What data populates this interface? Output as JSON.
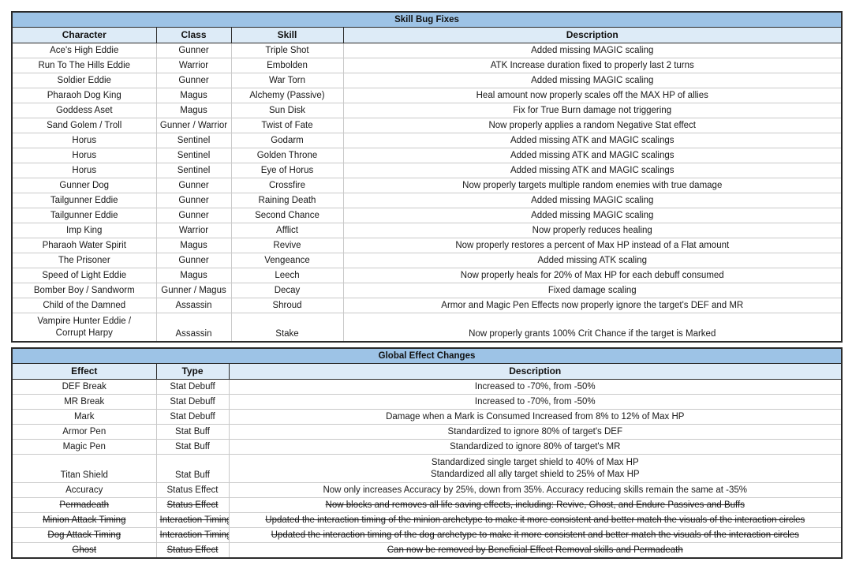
{
  "colors": {
    "title_bar": "#9DC3E6",
    "header_bar": "#DDEBF7",
    "body_text": "#1A1A1A",
    "blue_text": "#5B87DA",
    "struck_text": "#FF2A2A",
    "grid_line": "#C9C9C9",
    "outer_border": "#2B2B2B"
  },
  "skill_bug_fixes": {
    "title": "Skill Bug Fixes",
    "columns": [
      "Character",
      "Class",
      "Skill",
      "Description"
    ],
    "rows": [
      {
        "character": "Ace's High Eddie",
        "class": "Gunner",
        "skill": "Triple Shot",
        "description": "Added missing MAGIC scaling",
        "style": "normal"
      },
      {
        "character": "Run To The Hills Eddie",
        "class": "Warrior",
        "skill": "Embolden",
        "description": "ATK Increase duration fixed to properly last 2 turns",
        "style": "normal"
      },
      {
        "character": "Soldier Eddie",
        "class": "Gunner",
        "skill": "War Torn",
        "description": "Added missing MAGIC scaling",
        "style": "normal"
      },
      {
        "character": "Pharaoh Dog King",
        "class": "Magus",
        "skill": "Alchemy (Passive)",
        "description": "Heal amount now properly scales off the MAX HP of allies",
        "style": "normal"
      },
      {
        "character": "Goddess Aset",
        "class": "Magus",
        "skill": "Sun Disk",
        "description": "Fix for True Burn damage not triggering",
        "style": "normal"
      },
      {
        "character": "Sand Golem / Troll",
        "class": "Gunner / Warrior",
        "skill": "Twist of Fate",
        "description": "Now properly applies a random Negative Stat effect",
        "style": "normal"
      },
      {
        "character": "Horus",
        "class": "Sentinel",
        "skill": "Godarm",
        "description": "Added missing ATK and MAGIC scalings",
        "style": "normal"
      },
      {
        "character": "Horus",
        "class": "Sentinel",
        "skill": "Golden Throne",
        "description": "Added missing ATK and MAGIC scalings",
        "style": "normal"
      },
      {
        "character": "Horus",
        "class": "Sentinel",
        "skill": "Eye of Horus",
        "description": "Added missing ATK and MAGIC scalings",
        "style": "normal"
      },
      {
        "character": "Gunner Dog",
        "class": "Gunner",
        "skill": "Crossfire",
        "description": "Now properly targets multiple random enemies with true damage",
        "style": "normal"
      },
      {
        "character": "Tailgunner Eddie",
        "class": "Gunner",
        "skill": "Raining Death",
        "description": "Added missing MAGIC scaling",
        "style": "normal"
      },
      {
        "character": "Tailgunner Eddie",
        "class": "Gunner",
        "skill": "Second Chance",
        "description": "Added missing MAGIC scaling",
        "style": "normal"
      },
      {
        "character": "Imp King",
        "class": "Warrior",
        "skill": "Afflict",
        "description": "Now properly reduces healing",
        "style": "normal"
      },
      {
        "character": "Pharaoh Water Spirit",
        "class": "Magus",
        "skill": "Revive",
        "description": "Now properly restores a percent of Max HP instead of a Flat amount",
        "style": "blue"
      },
      {
        "character": "The Prisoner",
        "class": "Gunner",
        "skill": "Vengeance",
        "description": "Added missing ATK scaling",
        "style": "blue"
      },
      {
        "character": "Speed of Light Eddie",
        "class": "Magus",
        "skill": "Leech",
        "description": "Now properly heals for 20% of Max HP for each debuff consumed",
        "style": "blue"
      },
      {
        "character": "Bomber Boy / Sandworm",
        "class": "Gunner / Magus",
        "skill": "Decay",
        "description": "Fixed damage scaling",
        "style": "blue"
      },
      {
        "character": "Child of the Damned",
        "class": "Assassin",
        "skill": "Shroud",
        "description": "Armor and Magic Pen Effects now properly ignore the target's DEF and MR",
        "style": "blue"
      },
      {
        "character": "Vampire Hunter Eddie /\nCorrupt Harpy",
        "class": "Assassin",
        "skill": "Stake",
        "description": "Now properly grants 100% Crit Chance if the target is Marked",
        "style": "blue",
        "tall": true
      }
    ]
  },
  "global_effect_changes": {
    "title": "Global Effect Changes",
    "columns": [
      "Effect",
      "Type",
      "Description"
    ],
    "rows": [
      {
        "effect": "DEF Break",
        "type": "Stat Debuff",
        "description": "Increased to -70%, from -50%",
        "style": "normal"
      },
      {
        "effect": "MR Break",
        "type": "Stat Debuff",
        "description": "Increased to -70%, from -50%",
        "style": "normal"
      },
      {
        "effect": "Mark",
        "type": "Stat Debuff",
        "description": "Damage when a Mark is Consumed Increased from 8% to 12% of Max HP",
        "style": "normal"
      },
      {
        "effect": "Armor Pen",
        "type": "Stat Buff",
        "description": "Standardized to ignore 80% of target's DEF",
        "style": "blue"
      },
      {
        "effect": "Magic Pen",
        "type": "Stat Buff",
        "description": "Standardized to ignore 80% of target's MR",
        "style": "blue"
      },
      {
        "effect": "Titan Shield",
        "type": "Stat Buff",
        "description": "Standardized single target shield to 40% of Max HP\nStandardized all ally target shield to 25% of Max HP",
        "style": "blue",
        "tall": true
      },
      {
        "effect": "Accuracy",
        "type": "Status Effect",
        "description": "Now only increases Accuracy by 25%, down from 35%. Accuracy reducing skills remain the same at -35%",
        "style": "normal"
      },
      {
        "effect": "Permadeath",
        "type": "Status Effect",
        "description": "Now blocks and removes all life saving effects, including: Revive, Ghost, and Endure Passives and Buffs",
        "style": "struck"
      },
      {
        "effect": "Minion Attack Timing",
        "type": "Interaction Timing",
        "description": "Updated the interaction timing of the minion archetype to make it more consistent and better match the visuals of the interaction circles",
        "style": "struck"
      },
      {
        "effect": "Dog Attack Timing",
        "type": "Interaction Timing",
        "description": "Updated the interaction timing of the dog archetype to make it more consistent and better match the visuals of the interaction circles",
        "style": "struck"
      },
      {
        "effect": "Ghost",
        "type": "Status Effect",
        "description": "Can now be removed by Beneficial Effect Removal skills and Permadeath",
        "style": "struck"
      }
    ]
  }
}
